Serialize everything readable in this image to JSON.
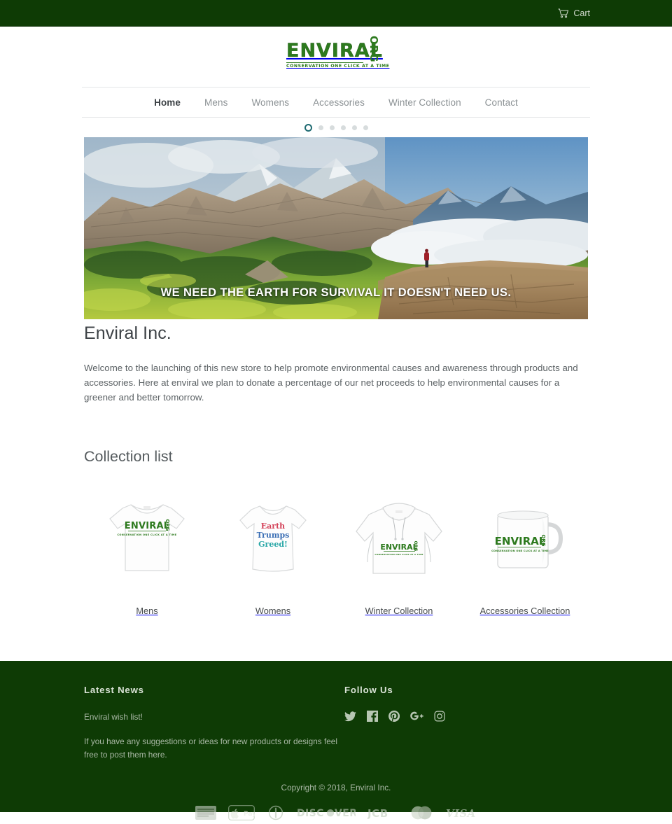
{
  "topbar": {
    "cart_label": "Cart",
    "cart_icon": "shopping-cart-icon"
  },
  "logo": {
    "main": "ENVIRAL",
    "org": "ORG",
    "tagline": "CONSERVATION ONE CLICK AT A TIME",
    "color": "#2d7a1e"
  },
  "nav": {
    "items": [
      {
        "label": "Home",
        "active": true
      },
      {
        "label": "Mens",
        "active": false
      },
      {
        "label": "Womens",
        "active": false
      },
      {
        "label": "Accessories",
        "active": false
      },
      {
        "label": "Winter Collection",
        "active": false
      },
      {
        "label": "Contact",
        "active": false
      }
    ]
  },
  "slideshow": {
    "dot_count": 6,
    "active_index": 0,
    "active_color": "#1f6b72",
    "inactive_color": "#d7dcdd"
  },
  "hero": {
    "caption": "WE NEED THE EARTH FOR SURVIVAL IT DOESN'T NEED US.",
    "alt": "Mountain cliff landscape with a person in a red jacket standing at the edge"
  },
  "intro": {
    "title": "Enviral Inc.",
    "body": " Welcome to the launching of this new store to help promote environmental causes and awareness through products and accessories. Here at enviral we plan to donate a percentage of our net proceeds to help environmental causes for a greener and better tomorrow."
  },
  "collections": {
    "heading": "Collection list",
    "items": [
      {
        "name": "Mens",
        "product": "white-tshirt"
      },
      {
        "name": "Womens",
        "product": "white-womens-tee"
      },
      {
        "name": "Winter Collection",
        "product": "white-hoodie"
      },
      {
        "name": "Accessories Collection",
        "product": "white-mug"
      }
    ],
    "womens_print": {
      "line1": "Earth",
      "line2": "Trumps",
      "line3": "Greed!",
      "color1": "#d4435a",
      "color2": "#3b6fb5",
      "color3": "#2ba8a8"
    }
  },
  "footer": {
    "news": {
      "heading": "Latest News",
      "post_title": "Enviral wish list!",
      "post_body": "If you have any suggestions or ideas for new products or designs feel free to post them here."
    },
    "follow": {
      "heading": "Follow Us",
      "socials": [
        {
          "name": "twitter-icon",
          "label": "Twitter"
        },
        {
          "name": "facebook-icon",
          "label": "Facebook"
        },
        {
          "name": "pinterest-icon",
          "label": "Pinterest"
        },
        {
          "name": "google-plus-icon",
          "label": "Google Plus"
        },
        {
          "name": "instagram-icon",
          "label": "Instagram"
        }
      ]
    },
    "copyright": "Copyright © 2018, Enviral Inc.",
    "payments": [
      "American Express",
      "Apple Pay",
      "Diners Club",
      "DISCOVER",
      "JCB",
      "Mastercard",
      "VISA"
    ],
    "background": "#0e3b05"
  }
}
